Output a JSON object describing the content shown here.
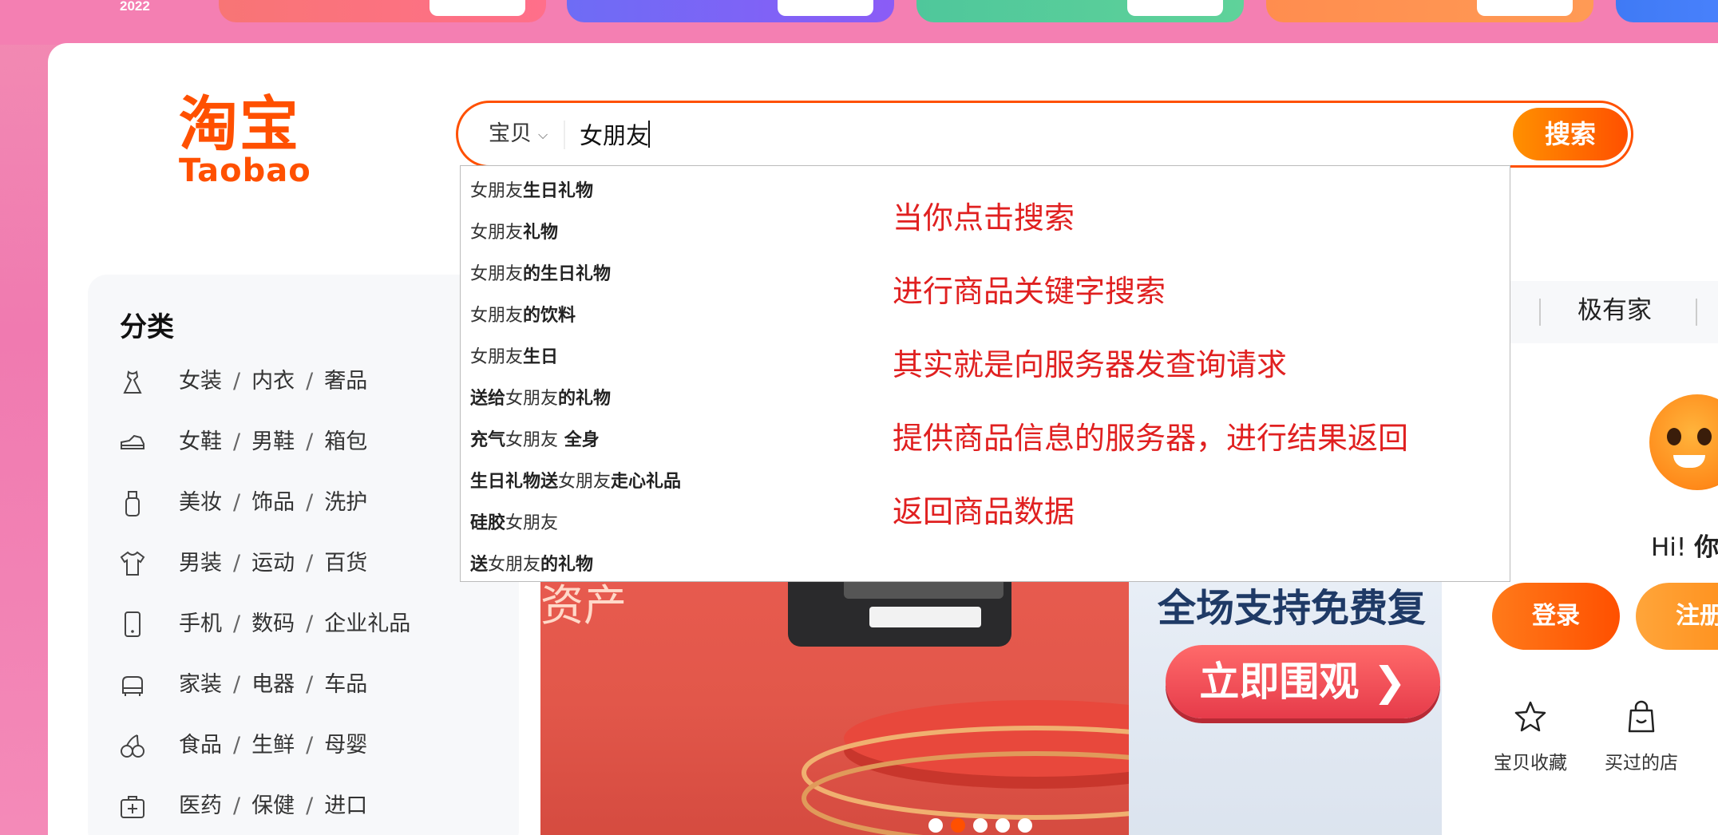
{
  "promo": {
    "year": "2022"
  },
  "logo": {
    "cn": "淘宝",
    "en": "Taobao"
  },
  "search": {
    "type_label": "宝贝",
    "query": "女朋友",
    "button": "搜索"
  },
  "suggestions": [
    [
      {
        "t": "女朋友",
        "b": false
      },
      {
        "t": "生日礼物",
        "b": true
      }
    ],
    [
      {
        "t": "女朋友",
        "b": false
      },
      {
        "t": "礼物",
        "b": true
      }
    ],
    [
      {
        "t": "女朋友",
        "b": false
      },
      {
        "t": "的生日礼物",
        "b": true
      }
    ],
    [
      {
        "t": "女朋友",
        "b": false
      },
      {
        "t": "的饮料",
        "b": true
      }
    ],
    [
      {
        "t": "女朋友",
        "b": false
      },
      {
        "t": "生日",
        "b": true
      }
    ],
    [
      {
        "t": "送给",
        "b": true
      },
      {
        "t": "女朋友",
        "b": false
      },
      {
        "t": "的礼物",
        "b": true
      }
    ],
    [
      {
        "t": "充气",
        "b": true
      },
      {
        "t": "女朋友",
        "b": false
      },
      {
        "t": " 全身",
        "b": true
      }
    ],
    [
      {
        "t": "生日礼物送",
        "b": true
      },
      {
        "t": "女朋友",
        "b": false
      },
      {
        "t": "走心礼品",
        "b": true
      }
    ],
    [
      {
        "t": "硅胶",
        "b": true
      },
      {
        "t": "女朋友",
        "b": false
      }
    ],
    [
      {
        "t": "送",
        "b": true
      },
      {
        "t": "女朋友",
        "b": false
      },
      {
        "t": "的礼物",
        "b": true
      }
    ]
  ],
  "annotations": [
    "当你点击搜索",
    "进行商品关键字搜索",
    "其实就是向服务器发查询请求",
    "提供商品信息的服务器，进行结果返回",
    "返回商品数据"
  ],
  "categories": {
    "title": "分类",
    "rows": [
      {
        "icon": "dress-icon",
        "items": [
          "女装",
          "内衣",
          "奢品"
        ]
      },
      {
        "icon": "shoe-icon",
        "items": [
          "女鞋",
          "男鞋",
          "箱包"
        ]
      },
      {
        "icon": "cosmetics-icon",
        "items": [
          "美妆",
          "饰品",
          "洗护"
        ]
      },
      {
        "icon": "tshirt-icon",
        "items": [
          "男装",
          "运动",
          "百货"
        ]
      },
      {
        "icon": "phone-icon",
        "items": [
          "手机",
          "数码",
          "企业礼品"
        ]
      },
      {
        "icon": "sofa-icon",
        "items": [
          "家装",
          "电器",
          "车品"
        ]
      },
      {
        "icon": "cherry-icon",
        "items": [
          "食品",
          "生鲜",
          "母婴"
        ]
      },
      {
        "icon": "medkit-icon",
        "items": [
          "医药",
          "保健",
          "进口"
        ]
      }
    ]
  },
  "banner": {
    "left_text": "资产",
    "right_text": "全场支持免费复",
    "cta": "立即围观 ❯",
    "dots": 5,
    "active_dot": 1
  },
  "nav": {
    "item": "极有家"
  },
  "user": {
    "greeting_prefix": "Hi! ",
    "greeting_name": "你",
    "login": "登录",
    "register": "注册",
    "quick_links": [
      {
        "icon": "star-icon",
        "label": "宝贝收藏"
      },
      {
        "icon": "bag-icon",
        "label": "买过的店"
      }
    ]
  },
  "colors": {
    "brand": "#ff5000",
    "annotation": "#e02020"
  }
}
